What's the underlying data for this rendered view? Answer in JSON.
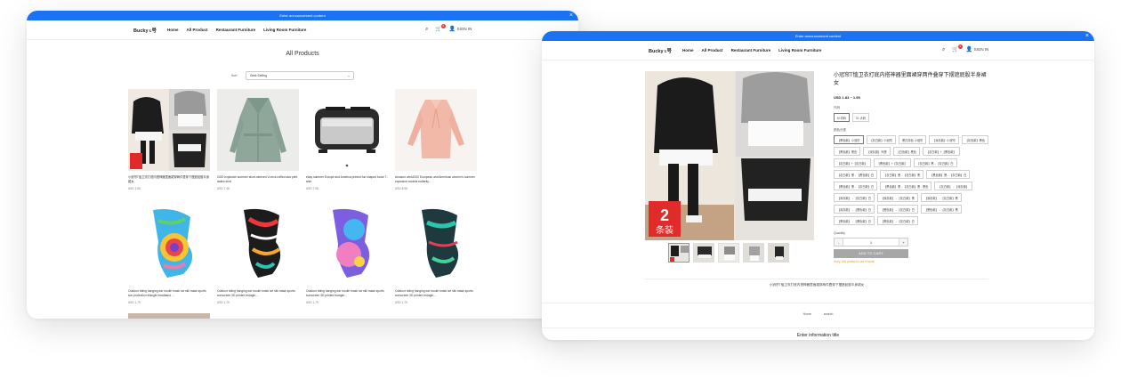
{
  "shop": {
    "announcement": "Enter announcement content",
    "logo": "Bucky ʟ号",
    "nav": [
      "Home",
      "All Product",
      "Restaurant Furniture",
      "Living Room Furniture"
    ],
    "signin": "SIGN IN",
    "cart_count": "0"
  },
  "listing": {
    "title": "All Products",
    "sort_label": "Sort",
    "sort_value": "Best Selling",
    "products": [
      {
        "title": "小冠帘T恤卫衣打底内搭神器里面裙穿两件叠穿下摆遮屁股半身裙女",
        "price": "USD 1.95"
      },
      {
        "title": "2020 explosive summer short-sleeved V-neck ruffled star print ladies shirt",
        "price": "USD 7.46"
      },
      {
        "title": "ebay summer Europe and America printed fun shaped loose T-shirt",
        "price": "USD 7.96"
      },
      {
        "title": "Amazon wish2020 European and American women's summer explosive models butterfly...",
        "price": "USD 8.95"
      },
      {
        "title": "Outdoor riding hanging ear mouth mask ice silk mask sports sun protection triangle headband ...",
        "price": "USD 1.79"
      },
      {
        "title": "Outdoor riding hanging ear mouth mask ice silk mask sports sunscreen 3D printed triangle...",
        "price": "USD 1.79"
      },
      {
        "title": "Outdoor riding hanging ear mouth mask ice silk mask sports sunscreen 3D printed triangle...",
        "price": "USD 1.79"
      },
      {
        "title": "Outdoor riding hanging ear mouth mask ice silk mask sports sunscreen 3D printed triangle...",
        "price": "USD 1.79"
      }
    ]
  },
  "product": {
    "title": "小冠帘T恤卫衣打底内搭神器里面裙穿两件叠穿下摆遮屁股半身裙女",
    "price": "USD 1.83 ~ 1.95",
    "size_label": "尺码",
    "sizes": [
      "M 均码",
      "XL 大码"
    ],
    "color_label": "颜色分类",
    "colors": [
      "【黑色款】小冠帘",
      "【灰白款】小冠帘",
      "黑白撞色 小冠帘",
      "【深灰款】小冠帘",
      "【灰色款】黑色",
      "【黑色款】黑色",
      "【深灰款】外搭",
      "【白色款】黑色",
      "【灰白款】+【黑色款】",
      "【灰白款】+【灰白款】",
      "【黑色款】+【灰白款】",
      "【灰白款】黑 - 【灰白款】白",
      "【灰白款】黑 - 【黑色款】白",
      "【灰白款】黑 - 【灰白款】黑",
      "【黑色款】黑 - 【灰白款】白",
      "【黑色款】黑 - 【灰白款】白",
      "【黑色款】黑 - 【灰白款】黑 - 黑色",
      "【灰白款】 - 【深灰款】",
      "【深灰款】 - 【灰白款】白",
      "【深灰款】 - 【灰白款】黑",
      "【深灰款】 - 【灰白款】黑",
      "【深灰款】 - 【黑色款】白",
      "【黑色款】 - 【灰白款】白",
      "【黑色款】 - 【灰白款】黑",
      "【黑色款】 - 【黑色款】白",
      "【黑色款】 - 【灰白款】白"
    ],
    "quantity_label": "Quantity",
    "quantity": "1",
    "minus": "-",
    "plus": "+",
    "add_to_cart": "ADD TO CART",
    "stock_note": "Sorry, this product is out of stock",
    "description": "小冠帘T恤卫衣打底内搭神器里面裙穿两件叠穿下摆遮屁股半身裙女",
    "badge_number": "2",
    "badge_text": "条装"
  },
  "footer": {
    "links": [
      "Home",
      "search"
    ],
    "info_title": "Enter information title"
  },
  "colors": {
    "announcement_bar": "#1a73f5",
    "badge_red": "#e53935",
    "add_to_cart_bg": "#a7a7a7",
    "note": "#d4a02c"
  }
}
